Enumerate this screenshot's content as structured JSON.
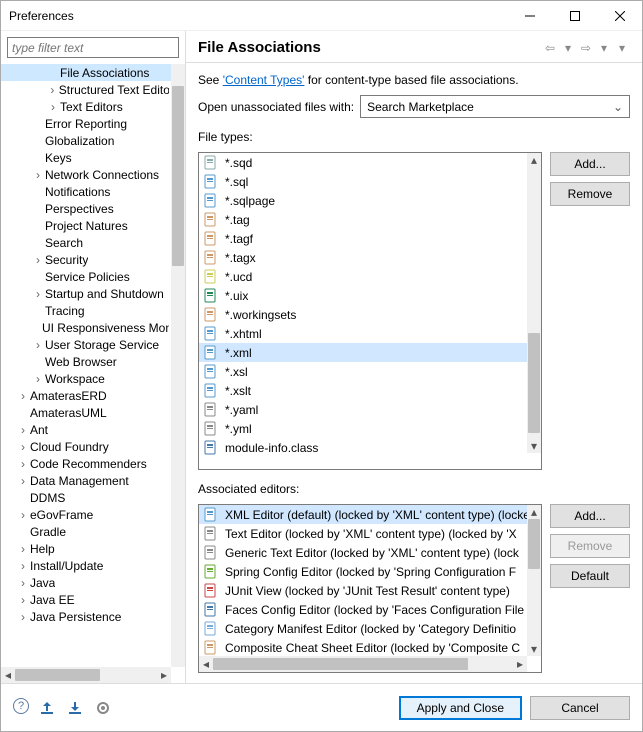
{
  "window": {
    "title": "Preferences"
  },
  "sidebar": {
    "filter_placeholder": "type filter text",
    "items": [
      {
        "label": "File Associations",
        "depth": 3,
        "expander": "",
        "selected": true
      },
      {
        "label": "Structured Text Editors",
        "depth": 3,
        "expander": ">"
      },
      {
        "label": "Text Editors",
        "depth": 3,
        "expander": ">"
      },
      {
        "label": "Error Reporting",
        "depth": 2,
        "expander": ""
      },
      {
        "label": "Globalization",
        "depth": 2,
        "expander": ""
      },
      {
        "label": "Keys",
        "depth": 2,
        "expander": ""
      },
      {
        "label": "Network Connections",
        "depth": 2,
        "expander": ">"
      },
      {
        "label": "Notifications",
        "depth": 2,
        "expander": ""
      },
      {
        "label": "Perspectives",
        "depth": 2,
        "expander": ""
      },
      {
        "label": "Project Natures",
        "depth": 2,
        "expander": ""
      },
      {
        "label": "Search",
        "depth": 2,
        "expander": ""
      },
      {
        "label": "Security",
        "depth": 2,
        "expander": ">"
      },
      {
        "label": "Service Policies",
        "depth": 2,
        "expander": ""
      },
      {
        "label": "Startup and Shutdown",
        "depth": 2,
        "expander": ">"
      },
      {
        "label": "Tracing",
        "depth": 2,
        "expander": ""
      },
      {
        "label": "UI Responsiveness Monitoring",
        "depth": 2,
        "expander": ""
      },
      {
        "label": "User Storage Service",
        "depth": 2,
        "expander": ">"
      },
      {
        "label": "Web Browser",
        "depth": 2,
        "expander": ""
      },
      {
        "label": "Workspace",
        "depth": 2,
        "expander": ">"
      },
      {
        "label": "AmaterasERD",
        "depth": 1,
        "expander": ">"
      },
      {
        "label": "AmaterasUML",
        "depth": 1,
        "expander": ""
      },
      {
        "label": "Ant",
        "depth": 1,
        "expander": ">"
      },
      {
        "label": "Cloud Foundry",
        "depth": 1,
        "expander": ">"
      },
      {
        "label": "Code Recommenders",
        "depth": 1,
        "expander": ">"
      },
      {
        "label": "Data Management",
        "depth": 1,
        "expander": ">"
      },
      {
        "label": "DDMS",
        "depth": 1,
        "expander": ""
      },
      {
        "label": "eGovFrame",
        "depth": 1,
        "expander": ">"
      },
      {
        "label": "Gradle",
        "depth": 1,
        "expander": ""
      },
      {
        "label": "Help",
        "depth": 1,
        "expander": ">"
      },
      {
        "label": "Install/Update",
        "depth": 1,
        "expander": ">"
      },
      {
        "label": "Java",
        "depth": 1,
        "expander": ">"
      },
      {
        "label": "Java EE",
        "depth": 1,
        "expander": ">"
      },
      {
        "label": "Java Persistence",
        "depth": 1,
        "expander": ">"
      }
    ]
  },
  "main": {
    "title": "File Associations",
    "desc_prefix": "See ",
    "desc_link": "'Content Types'",
    "desc_suffix": " for content-type based file associations.",
    "open_label": "Open unassociated files with:",
    "open_value": "Search Marketplace",
    "filetypes_label": "File types:",
    "filetypes": [
      {
        "label": "*.sqd",
        "icon": "sqd"
      },
      {
        "label": "*.sql",
        "icon": "sql"
      },
      {
        "label": "*.sqlpage",
        "icon": "sqlpage"
      },
      {
        "label": "*.tag",
        "icon": "tag"
      },
      {
        "label": "*.tagf",
        "icon": "tag"
      },
      {
        "label": "*.tagx",
        "icon": "tag"
      },
      {
        "label": "*.ucd",
        "icon": "ucd"
      },
      {
        "label": "*.uix",
        "icon": "uix"
      },
      {
        "label": "*.workingsets",
        "icon": "workingsets"
      },
      {
        "label": "*.xhtml",
        "icon": "xhtml"
      },
      {
        "label": "*.xml",
        "icon": "xml",
        "selected": true
      },
      {
        "label": "*.xsl",
        "icon": "xsl"
      },
      {
        "label": "*.xslt",
        "icon": "xslt"
      },
      {
        "label": "*.yaml",
        "icon": "text"
      },
      {
        "label": "*.yml",
        "icon": "text"
      },
      {
        "label": "module-info.class",
        "icon": "class"
      }
    ],
    "ft_buttons": {
      "add": "Add...",
      "remove": "Remove"
    },
    "editors_label": "Associated editors:",
    "editors": [
      {
        "label": "XML Editor (default) (locked by 'XML' content type) (locked by '",
        "icon": "xml",
        "selected": true
      },
      {
        "label": "Text Editor (locked by 'XML' content type) (locked by 'X",
        "icon": "text"
      },
      {
        "label": "Generic Text Editor (locked by 'XML' content type) (lock",
        "icon": "text"
      },
      {
        "label": "Spring Config Editor (locked by 'Spring Configuration F",
        "icon": "spring"
      },
      {
        "label": "JUnit View (locked by 'JUnit Test Result' content type)",
        "icon": "junit"
      },
      {
        "label": "Faces Config Editor (locked by 'Faces Configuration File",
        "icon": "faces"
      },
      {
        "label": "Category Manifest Editor (locked by 'Category Definitio",
        "icon": "category"
      },
      {
        "label": "Composite Cheat Sheet Editor (locked by 'Composite C",
        "icon": "composite"
      }
    ],
    "ed_buttons": {
      "add": "Add...",
      "remove": "Remove",
      "default": "Default"
    }
  },
  "footer": {
    "apply": "Apply and Close",
    "cancel": "Cancel"
  }
}
